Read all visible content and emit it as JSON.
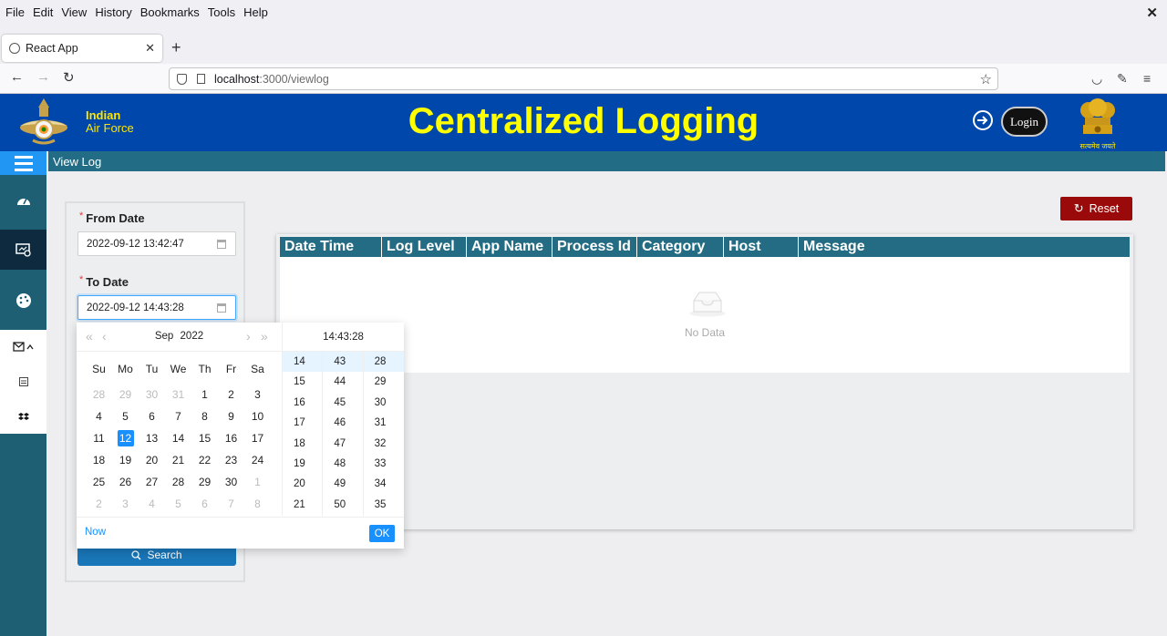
{
  "browser": {
    "menu": [
      "File",
      "Edit",
      "View",
      "History",
      "Bookmarks",
      "Tools",
      "Help"
    ],
    "tab_title": "React App",
    "url_host": "localhost",
    "url_path": ":3000/viewlog"
  },
  "header": {
    "org_line1": "Indian",
    "org_line2": "Air Force",
    "title": "Centralized Logging",
    "login_label": "Login",
    "emblem_motto": "सत्यमेव जयते"
  },
  "breadcrumb": "View Log",
  "filter": {
    "from_label": "From Date",
    "from_value": "2022-09-12 13:42:47",
    "to_label": "To Date",
    "to_value": "2022-09-12 14:43:28",
    "search_label": "Search"
  },
  "reset_label": "Reset",
  "table": {
    "columns": [
      "Date Time",
      "Log Level",
      "App Name",
      "Process Id",
      "Category",
      "Host",
      "Message"
    ],
    "empty_text": "No Data"
  },
  "picker": {
    "month": "Sep",
    "year": "2022",
    "time": "14:43:28",
    "weekdays": [
      "Su",
      "Mo",
      "Tu",
      "We",
      "Th",
      "Fr",
      "Sa"
    ],
    "weeks": [
      [
        [
          "28",
          1
        ],
        [
          "29",
          1
        ],
        [
          "30",
          1
        ],
        [
          "31",
          1
        ],
        [
          "1",
          0
        ],
        [
          "2",
          0
        ],
        [
          "3",
          0
        ]
      ],
      [
        [
          "4",
          0
        ],
        [
          "5",
          0
        ],
        [
          "6",
          0
        ],
        [
          "7",
          0
        ],
        [
          "8",
          0
        ],
        [
          "9",
          0
        ],
        [
          "10",
          0
        ]
      ],
      [
        [
          "11",
          0
        ],
        [
          "12",
          2
        ],
        [
          "13",
          0
        ],
        [
          "14",
          0
        ],
        [
          "15",
          0
        ],
        [
          "16",
          0
        ],
        [
          "17",
          0
        ]
      ],
      [
        [
          "18",
          0
        ],
        [
          "19",
          0
        ],
        [
          "20",
          0
        ],
        [
          "21",
          0
        ],
        [
          "22",
          0
        ],
        [
          "23",
          0
        ],
        [
          "24",
          0
        ]
      ],
      [
        [
          "25",
          0
        ],
        [
          "26",
          0
        ],
        [
          "27",
          0
        ],
        [
          "28",
          0
        ],
        [
          "29",
          0
        ],
        [
          "30",
          0
        ],
        [
          "1",
          1
        ]
      ],
      [
        [
          "2",
          1
        ],
        [
          "3",
          1
        ],
        [
          "4",
          1
        ],
        [
          "5",
          1
        ],
        [
          "6",
          1
        ],
        [
          "7",
          1
        ],
        [
          "8",
          1
        ]
      ]
    ],
    "hours": [
      "14",
      "15",
      "16",
      "17",
      "18",
      "19",
      "20",
      "21"
    ],
    "minutes": [
      "43",
      "44",
      "45",
      "46",
      "47",
      "48",
      "49",
      "50"
    ],
    "seconds": [
      "28",
      "29",
      "30",
      "31",
      "32",
      "33",
      "34",
      "35"
    ],
    "now_label": "Now",
    "ok_label": "OK"
  }
}
